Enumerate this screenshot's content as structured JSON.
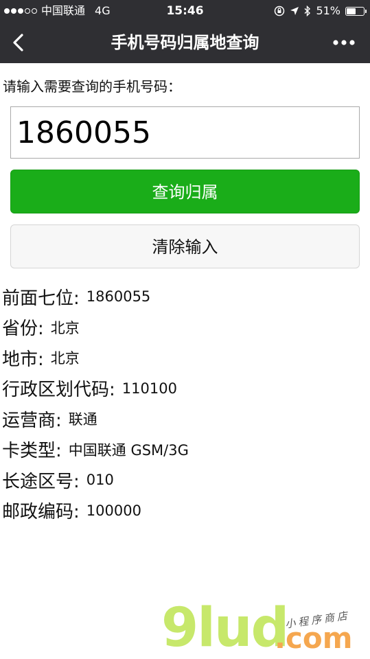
{
  "status_bar": {
    "carrier": "中国联通",
    "network": "4G",
    "time": "15:46",
    "battery": "51%",
    "battery_level": 0.51,
    "signal_strength": 3,
    "signal_total": 5
  },
  "navbar": {
    "title": "手机号码归属地查询",
    "back_icon": "chevron-left-icon",
    "more_icon": "more-dots-icon"
  },
  "form": {
    "prompt": "请输入需要查询的手机号码：",
    "phone_value": "1860055",
    "query_button": "查询归属",
    "clear_button": "清除输入"
  },
  "results": [
    {
      "label": "前面七位:",
      "value": "1860055"
    },
    {
      "label": "省份:",
      "value": "北京"
    },
    {
      "label": "地市:",
      "value": "北京"
    },
    {
      "label": "行政区划代码:",
      "value": "110100"
    },
    {
      "label": "运营商:",
      "value": "联通"
    },
    {
      "label": "卡类型:",
      "value": "中国联通 GSM/3G"
    },
    {
      "label": "长途区号:",
      "value": "010"
    },
    {
      "label": "邮政编码:",
      "value": "100000"
    }
  ],
  "watermark": {
    "brand": "9lud",
    "domain": ".com",
    "tagline": "小程序商店"
  },
  "colors": {
    "navbar_bg": "#2f2f33",
    "primary_green": "#1aad19",
    "clear_button_bg": "#f7f7f7"
  }
}
